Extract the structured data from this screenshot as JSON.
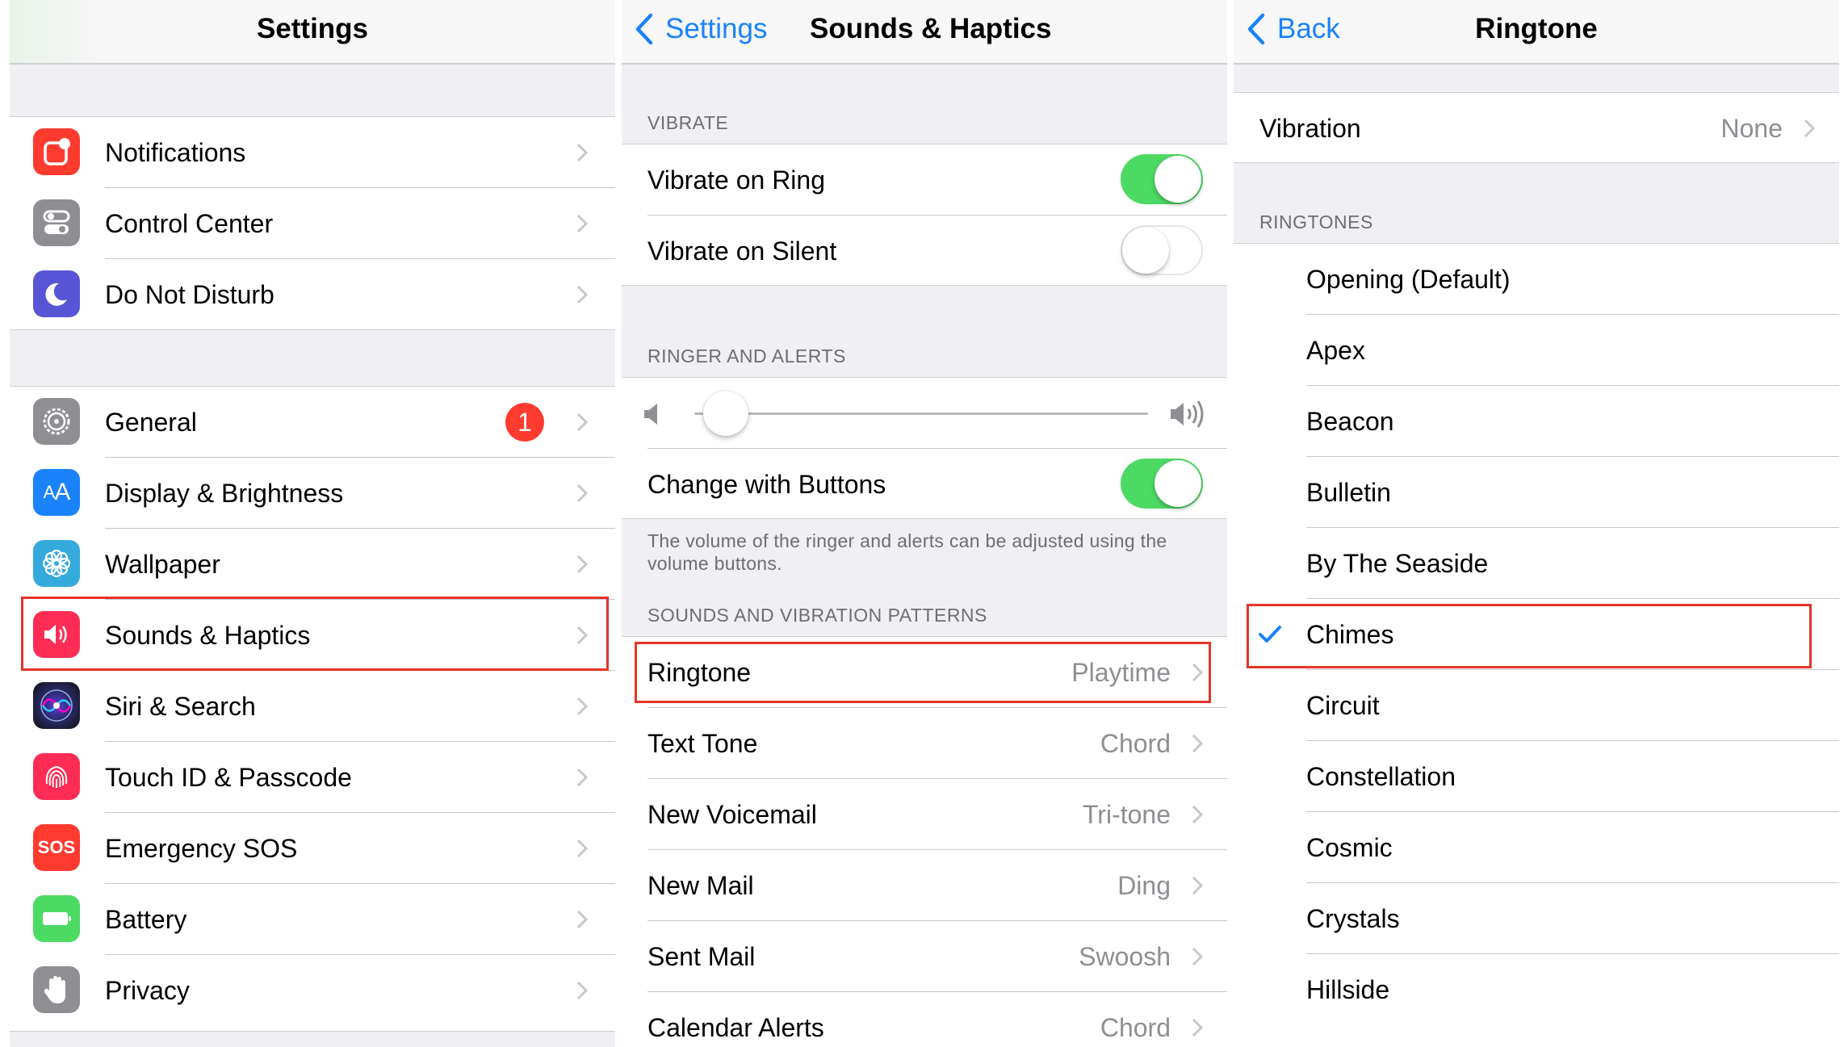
{
  "settings": {
    "title": "Settings",
    "group1": [
      {
        "label": "Notifications",
        "icon": "notifications-icon",
        "color": "#ff3b30"
      },
      {
        "label": "Control Center",
        "icon": "control-center-icon",
        "color": "#8e8e93"
      },
      {
        "label": "Do Not Disturb",
        "icon": "moon-icon",
        "color": "#5856d6"
      }
    ],
    "group2": [
      {
        "label": "General",
        "icon": "gear-icon",
        "color": "#8e8e93",
        "badge": "1"
      },
      {
        "label": "Display & Brightness",
        "icon": "display-icon",
        "color": "#1a82fb"
      },
      {
        "label": "Wallpaper",
        "icon": "wallpaper-icon",
        "color": "#35aadc"
      },
      {
        "label": "Sounds & Haptics",
        "icon": "speaker-icon",
        "color": "#ff2d55"
      },
      {
        "label": "Siri & Search",
        "icon": "siri-icon",
        "color": "#1c1c3a"
      },
      {
        "label": "Touch ID & Passcode",
        "icon": "fingerprint-icon",
        "color": "#ff2d55"
      },
      {
        "label": "Emergency SOS",
        "icon": "sos-icon",
        "color": "#ff3b30",
        "icon_text": "SOS"
      },
      {
        "label": "Battery",
        "icon": "battery-icon",
        "color": "#4cd964"
      },
      {
        "label": "Privacy",
        "icon": "hand-icon",
        "color": "#8e8e93"
      }
    ]
  },
  "sounds": {
    "back_label": "Settings",
    "title": "Sounds & Haptics",
    "vibrate_header": "VIBRATE",
    "vibrate_on_ring": "Vibrate on Ring",
    "vibrate_on_ring_on": true,
    "vibrate_on_silent": "Vibrate on Silent",
    "vibrate_on_silent_on": false,
    "ringer_header": "RINGER AND ALERTS",
    "volume_level": 0.02,
    "change_with_buttons": "Change with Buttons",
    "change_with_buttons_on": true,
    "ringer_footer": "The volume of the ringer and alerts can be adjusted using the volume buttons.",
    "patterns_header": "SOUNDS AND VIBRATION PATTERNS",
    "patterns": [
      {
        "label": "Ringtone",
        "value": "Playtime"
      },
      {
        "label": "Text Tone",
        "value": "Chord"
      },
      {
        "label": "New Voicemail",
        "value": "Tri-tone"
      },
      {
        "label": "New Mail",
        "value": "Ding"
      },
      {
        "label": "Sent Mail",
        "value": "Swoosh"
      },
      {
        "label": "Calendar Alerts",
        "value": "Chord"
      }
    ]
  },
  "ringtone": {
    "back_label": "Back",
    "title": "Ringtone",
    "vibration_label": "Vibration",
    "vibration_value": "None",
    "ringtones_header": "RINGTONES",
    "items": [
      "Opening (Default)",
      "Apex",
      "Beacon",
      "Bulletin",
      "By The Seaside",
      "Chimes",
      "Circuit",
      "Constellation",
      "Cosmic",
      "Crystals",
      "Hillside"
    ],
    "selected": "Chimes"
  },
  "colors": {
    "accent": "#1a82fb",
    "toggle_on": "#4cd964",
    "highlight": "#e5342a"
  }
}
